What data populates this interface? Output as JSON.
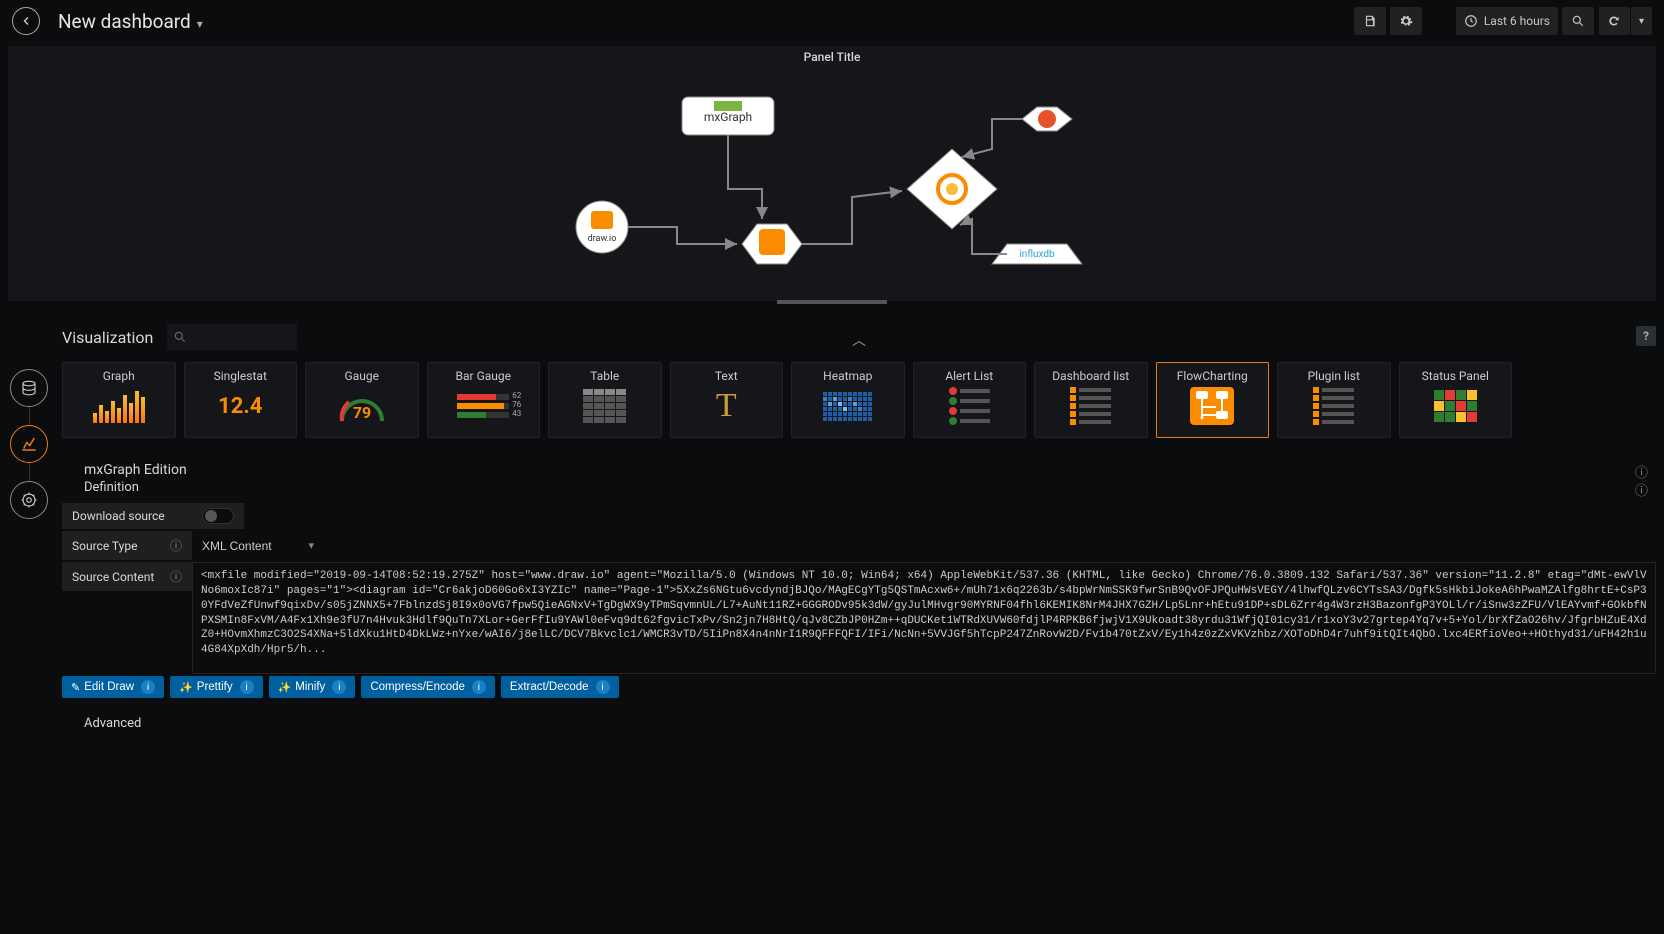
{
  "header": {
    "title": "New dashboard",
    "time_range": "Last 6 hours"
  },
  "panel": {
    "title": "Panel Title",
    "diagram_nodes": {
      "mxgraph": "mxGraph",
      "drawio": "draw.io",
      "influxdb": "influxdb"
    }
  },
  "visualization": {
    "section_title": "Visualization",
    "search_placeholder": "",
    "selected": "FlowCharting",
    "items": [
      {
        "label": "Graph"
      },
      {
        "label": "Singlestat",
        "value": "12.4"
      },
      {
        "label": "Gauge",
        "value": "79"
      },
      {
        "label": "Bar Gauge",
        "bars": [
          "62",
          "76",
          "43"
        ]
      },
      {
        "label": "Table"
      },
      {
        "label": "Text"
      },
      {
        "label": "Heatmap"
      },
      {
        "label": "Alert List"
      },
      {
        "label": "Dashboard list"
      },
      {
        "label": "FlowCharting"
      },
      {
        "label": "Plugin list"
      },
      {
        "label": "Status Panel"
      }
    ]
  },
  "options": {
    "heading": "mxGraph Edition",
    "subheading": "Definition",
    "download_source": {
      "label": "Download source",
      "value": false
    },
    "source_type": {
      "label": "Source Type",
      "value": "XML Content"
    },
    "source_content": {
      "label": "Source Content",
      "value": "<mxfile modified=\"2019-09-14T08:52:19.275Z\" host=\"www.draw.io\" agent=\"Mozilla/5.0 (Windows NT 10.0; Win64; x64) AppleWebKit/537.36 (KHTML, like Gecko) Chrome/76.0.3809.132 Safari/537.36\" version=\"11.2.8\" etag=\"dMt-ewVlVNo6moxIc87i\" pages=\"1\"><diagram id=\"Cr6akjoD60Go6xI3YZIc\" name=\"Page-1\">5XxZs6NGtu6vcdyndjBJQo/MAgECgYTg5QSTmAcxw6+/mUh71x6q2263b/s4bpWrNmSSK9fwrSnB9QvOFJPQuHWsVEGY/4lhwfQLzv6CYTsSA3/Dgfk5sHkbiJokeA6hPwaMZAlfg8hrtE+CsP30YFdVeZfUnwf9qixDv/s05jZNNX5+7FblnzdSj8I9x0oVG7fpw5QieAGNxV+TgDgWX9yTPmSqvmnUL/L7+AuNt11RZ+GGGRODv95k3dW/gyJulMHvgr90MYRNF04fhl6KEMIK8NrM4JHX7GZH/Lp5Lnr+hEtu91DP+sDL6Zrr4g4W3rzH3BazonfgP3YOLl/r/iSnw3zZFU/VlEAYvmf+GOkbfNPXSMIn8FxVM/A4Fx1Xh9e3fU7n4Hvuk3Hdlf9QuTn7XLor+GerFfIu9YAWl0eFvq9dt62fgvicTxPv/Sn2jn7H8HtQ/qJv8CZbJP0HZm++qDUCKet1WTRdXUVW60fdjlP4RPKB6fjwjV1X9Ukoadt38yrdu31WfjQI01cy31/r1xoY3v27grtep4Yq7v+5+Yol/brXfZaO26hv/JfgrbHZuE4XdZ0+HOvmXhmzC3O2S4XNa+5ldXku1HtD4DkLWz+nYxe/wAI6/j8elLC/DCV7Bkvclc1/WMCR3vTD/5IiPn8X4n4nNrI1R9QFFFQFI/IFi/NcNn+5VVJGf5hTcpP247ZnRovW2D/Fv1b470tZxV/Ey1h4z0zZxVKVzhbz/XOToDhD4r7uhf9itQIt4QbO.lxc4ERfioVeo++HOthyd31/uFH42h1u4G84XpXdh/Hpr5/h..."
    },
    "actions": {
      "edit_draw": "Edit Draw",
      "prettify": "Prettify",
      "minify": "Minify",
      "compress": "Compress/Encode",
      "extract": "Extract/Decode"
    },
    "advanced": "Advanced"
  }
}
